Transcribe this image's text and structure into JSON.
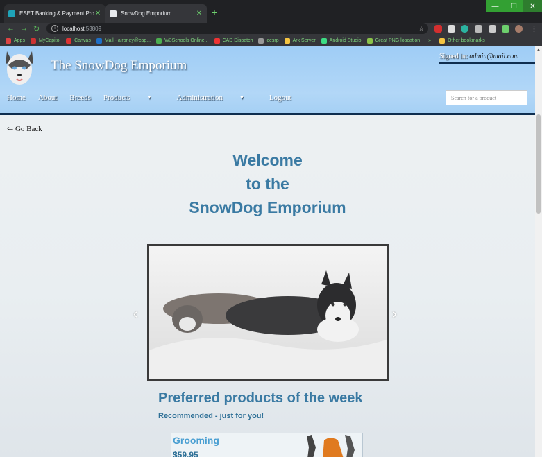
{
  "browser": {
    "tabs": [
      {
        "title": "ESET Banking & Payment Protect",
        "active": false
      },
      {
        "title": "SnowDog Emporium",
        "active": true
      }
    ],
    "address": {
      "host": "localhost",
      "port": ":53809"
    },
    "bookmarks": [
      "Apps",
      "MyCapitol",
      "Canvas",
      "Mail - alroney@cap...",
      "W3Schools Online...",
      "CAD Dispatch",
      "cesrp",
      "Ark Server",
      "Android Studio",
      "Great PNG loacation",
      "»",
      "Other bookmarks"
    ]
  },
  "header": {
    "brand": "The SnowDog Emporium",
    "signed_in_label": "Signed in:",
    "signed_in_user": "admin@mail.com",
    "nav": {
      "home": "Home",
      "about": "About",
      "breeds": "Breeds",
      "products": "Products",
      "administration": "Administration",
      "logout": "Logout"
    },
    "search_placeholder": "Search for a product"
  },
  "main": {
    "go_back": "Go Back",
    "welcome_lines": [
      "Welcome",
      "to the",
      "SnowDog Emporium"
    ],
    "preferred_title": "Preferred products of the week",
    "preferred_subtitle": "Recommended - just for you!",
    "product": {
      "name": "Grooming",
      "price": "$59.95"
    }
  },
  "colors": {
    "accent": "#3a7aa3",
    "header_bg": "#a6d0f4",
    "chrome_green": "#6dcf6d"
  }
}
